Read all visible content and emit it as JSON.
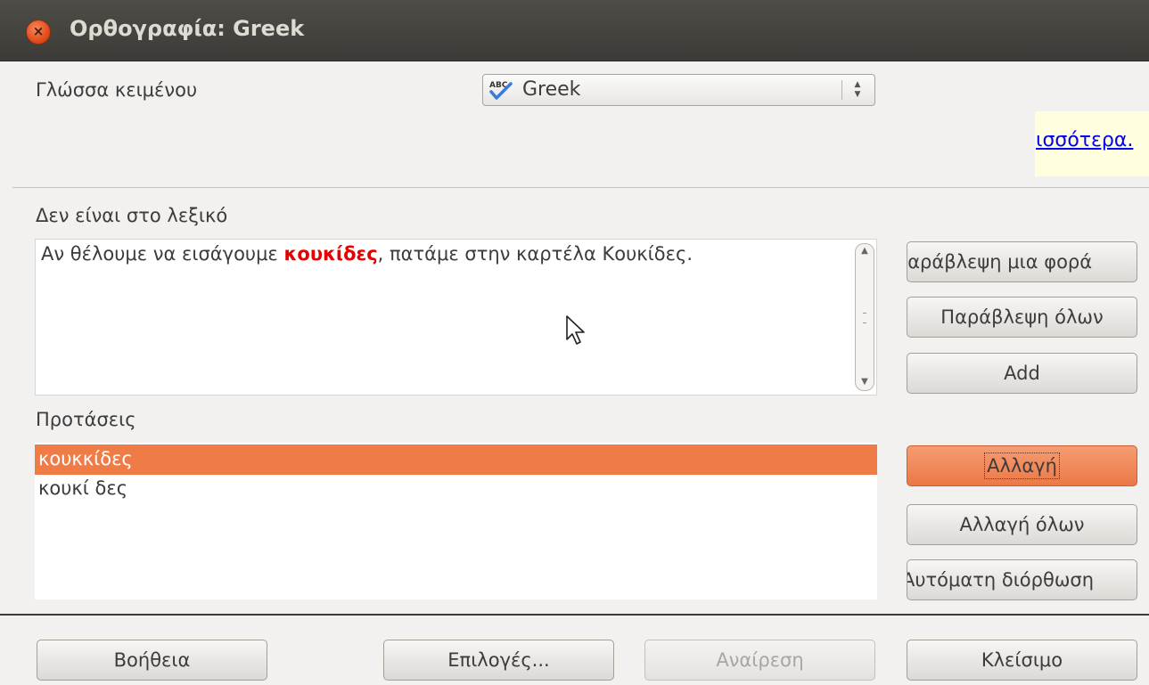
{
  "window": {
    "title": "Ορθογραφία: Greek",
    "close_icon": "close-icon"
  },
  "language": {
    "label": "Γλώσσα κειμένου",
    "value": "Greek",
    "icon": "spellcheck-abc-icon"
  },
  "more_link": {
    "text": "ισσότερα."
  },
  "not_in_dictionary": {
    "label": "Δεν είναι στο λεξικό",
    "sentence_before": "Αν θέλουμε να εισάγουμε ",
    "error_word": "κουκίδες",
    "sentence_after": ", πατάμε στην καρτέλα Κουκίδες."
  },
  "suggestions": {
    "label": "Προτάσεις",
    "items": [
      "κουκκίδες",
      "κουκί δες"
    ],
    "selected_index": 0
  },
  "buttons": {
    "ignore_once": "Ιαράβλεψη μια φορά",
    "ignore_all": "Παράβλεψη όλων",
    "add": "Add",
    "change": "Αλλαγή",
    "change_all": "Αλλαγή όλων",
    "autocorrect": "Αυτόματη διόρθωση",
    "help": "Βοήθεια",
    "options": "Επιλογές...",
    "undo": "Αναίρεση",
    "close": "Κλείσιμο"
  },
  "colors": {
    "accent": "#ef7b46",
    "error_text": "#e80000",
    "link": "#0000ee",
    "link_background": "#ffffdf",
    "titlebar": "#3c3b37"
  }
}
